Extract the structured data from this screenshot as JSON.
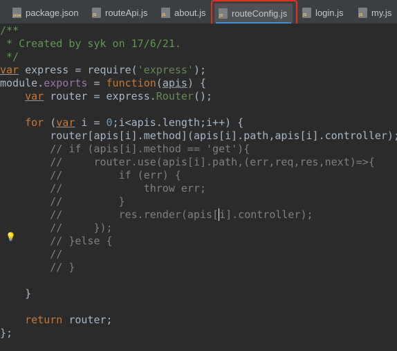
{
  "tabs": [
    {
      "label": "package.json",
      "icon": "json-file-icon"
    },
    {
      "label": "routeApi.js",
      "icon": "js-file-icon"
    },
    {
      "label": "about.js",
      "icon": "js-file-icon"
    },
    {
      "label": "routeConfig.js",
      "icon": "js-file-icon",
      "active": true
    },
    {
      "label": "login.js",
      "icon": "js-file-icon"
    },
    {
      "label": "my.js",
      "icon": "js-file-icon"
    }
  ],
  "code": {
    "l1": "/**",
    "l2": " * Created by syk on 17/6/21.",
    "l3": " */",
    "l4": {
      "k": "var",
      "rest": " express = require(",
      "s": "'express'",
      "end": ");"
    },
    "l5": {
      "a": "module.",
      "b": "exports",
      "c": " = ",
      "d": "function",
      "e": "(",
      "f": "apis",
      "g": ") {"
    },
    "l6": {
      "a": "    ",
      "k": "var",
      "b": " router = express.",
      "c": "Router",
      "d": "();"
    },
    "l8": {
      "a": "    ",
      "k1": "for",
      "b": " (",
      "k2": "var",
      "c": " i = ",
      "n": "0",
      "d": ";i<apis.length;i++) {"
    },
    "l9": "        router[apis[i].method](apis[i].path,apis[i].controller);",
    "l10": "        // if (apis[i].method == 'get'){",
    "l11": "        //     router.use(apis[i].path,(err,req,res,next)=>{",
    "l12": "        //         if (err) {",
    "l13": "        //             throw err;",
    "l14": "        //         }",
    "l15a": "        //         res.render(apis[",
    "l15b": "i",
    "l15c": "].controller);",
    "l16": "        //     });",
    "l17": "        // }else {",
    "l18": "        //",
    "l19": "        // }",
    "l21": "    }",
    "l23": {
      "a": "    ",
      "k": "return",
      "b": " router;"
    },
    "l24": "};"
  },
  "colors": {
    "background": "#2b2b2b",
    "tabbar": "#3c3f41",
    "highlight_box": "#e0331f",
    "comment": "#629755",
    "line_comment": "#808080",
    "keyword": "#cc7832",
    "string": "#6a8759"
  }
}
